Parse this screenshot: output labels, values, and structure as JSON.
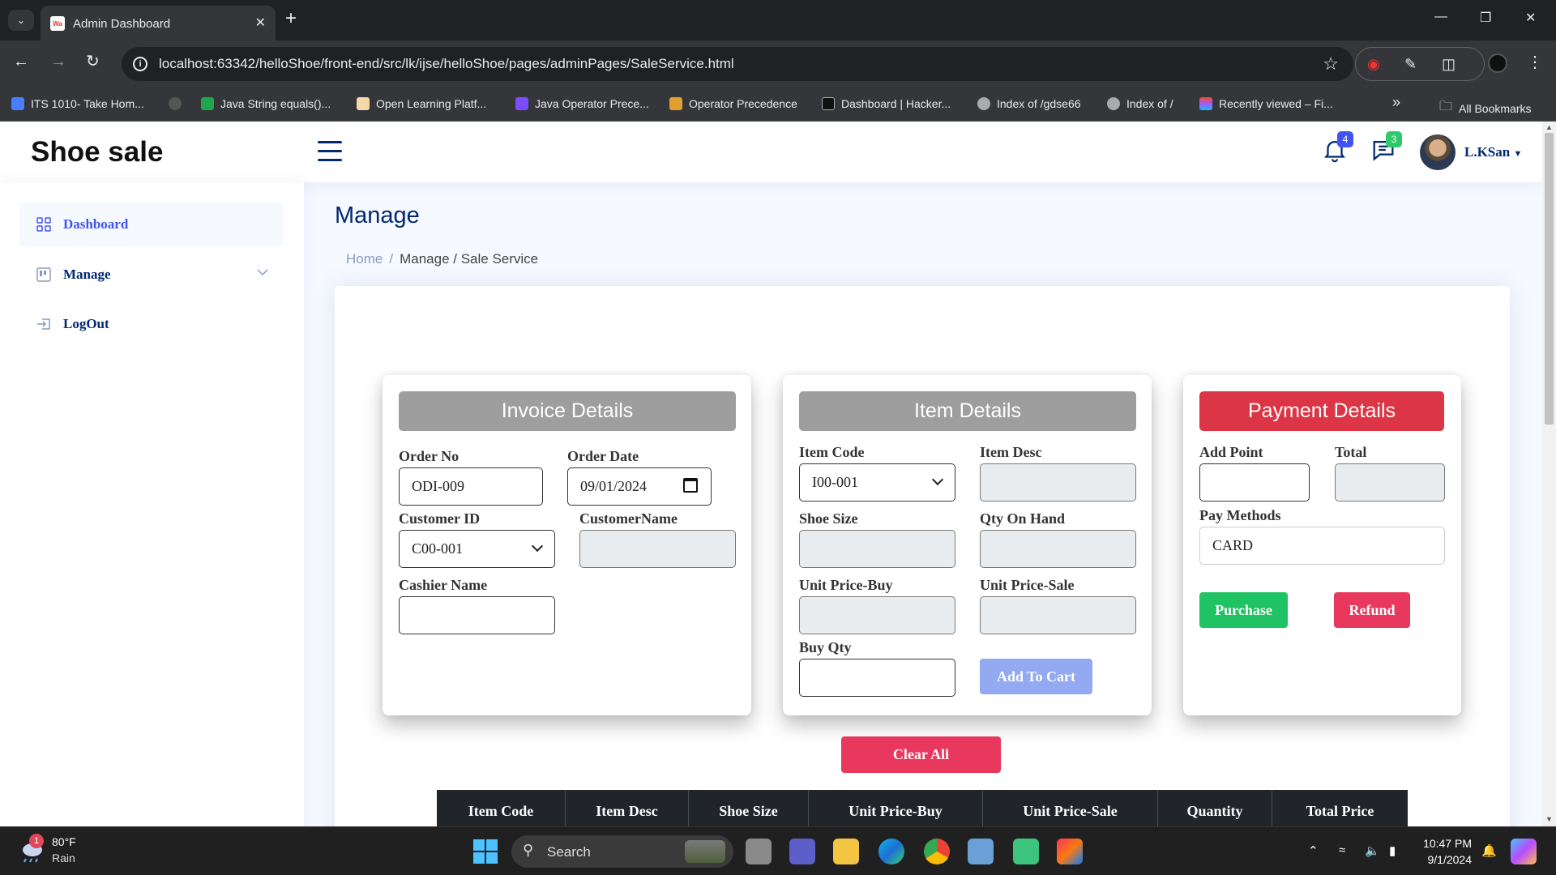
{
  "browser": {
    "tab_title": "Admin Dashboard",
    "url": "localhost:63342/helloShoe/front-end/src/lk/ijse/helloShoe/pages/adminPages/SaleService.html",
    "bookmarks": [
      "ITS 1010- Take Hom...",
      "Java String equals()...",
      "Open Learning Platf...",
      "Java Operator Prece...",
      "Operator Precedence",
      "Dashboard | Hacker...",
      "Index of /gdse66",
      "Index of /",
      "Recently viewed – Fi..."
    ],
    "all_bookmarks": "All Bookmarks"
  },
  "header": {
    "logo": "Shoe sale",
    "notifications_count": "4",
    "messages_count": "3",
    "user_name": "L.KSan"
  },
  "sidebar": {
    "items": [
      {
        "label": "Dashboard",
        "icon": "grid-icon"
      },
      {
        "label": "Manage",
        "icon": "menu-button-icon"
      },
      {
        "label": "LogOut",
        "icon": "box-arrow-in-right-icon"
      }
    ]
  },
  "main": {
    "title": "Manage",
    "breadcrumb": {
      "home": "Home",
      "current": "Manage / Sale Service"
    }
  },
  "invoice": {
    "title": "Invoice Details",
    "order_no_label": "Order No",
    "order_no_value": "ODI-009",
    "order_date_label": "Order Date",
    "order_date_value": "09/01/2024",
    "customer_id_label": "Customer ID",
    "customer_id_value": "C00-001",
    "customer_name_label": "CustomerName",
    "cashier_name_label": "Cashier Name"
  },
  "item": {
    "title": "Item Details",
    "item_code_label": "Item Code",
    "item_code_value": "I00-001",
    "item_desc_label": "Item Desc",
    "shoe_size_label": "Shoe Size",
    "qty_on_hand_label": "Qty On Hand",
    "unit_price_buy_label": "Unit Price-Buy",
    "unit_price_sale_label": "Unit Price-Sale",
    "buy_qty_label": "Buy Qty",
    "add_to_cart": "Add To Cart"
  },
  "payment": {
    "title": "Payment Details",
    "add_point_label": "Add Point",
    "total_label": "Total",
    "pay_methods_label": "Pay Methods",
    "pay_methods_value": "CARD",
    "purchase": "Purchase",
    "refund": "Refund"
  },
  "clear_all": "Clear All",
  "table": {
    "columns": [
      "Item Code",
      "Item Desc",
      "Shoe Size",
      "Unit Price-Buy",
      "Unit Price-Sale",
      "Quantity",
      "Total Price"
    ]
  },
  "taskbar": {
    "weather_temp": "80°F",
    "weather_cond": "Rain",
    "weather_badge": "1",
    "search": "Search",
    "time": "10:47 PM",
    "date": "9/1/2024"
  },
  "colors": {
    "brand": "#012970",
    "accent": "#4154f1",
    "danger": "#dc3545",
    "success": "#20c363"
  }
}
